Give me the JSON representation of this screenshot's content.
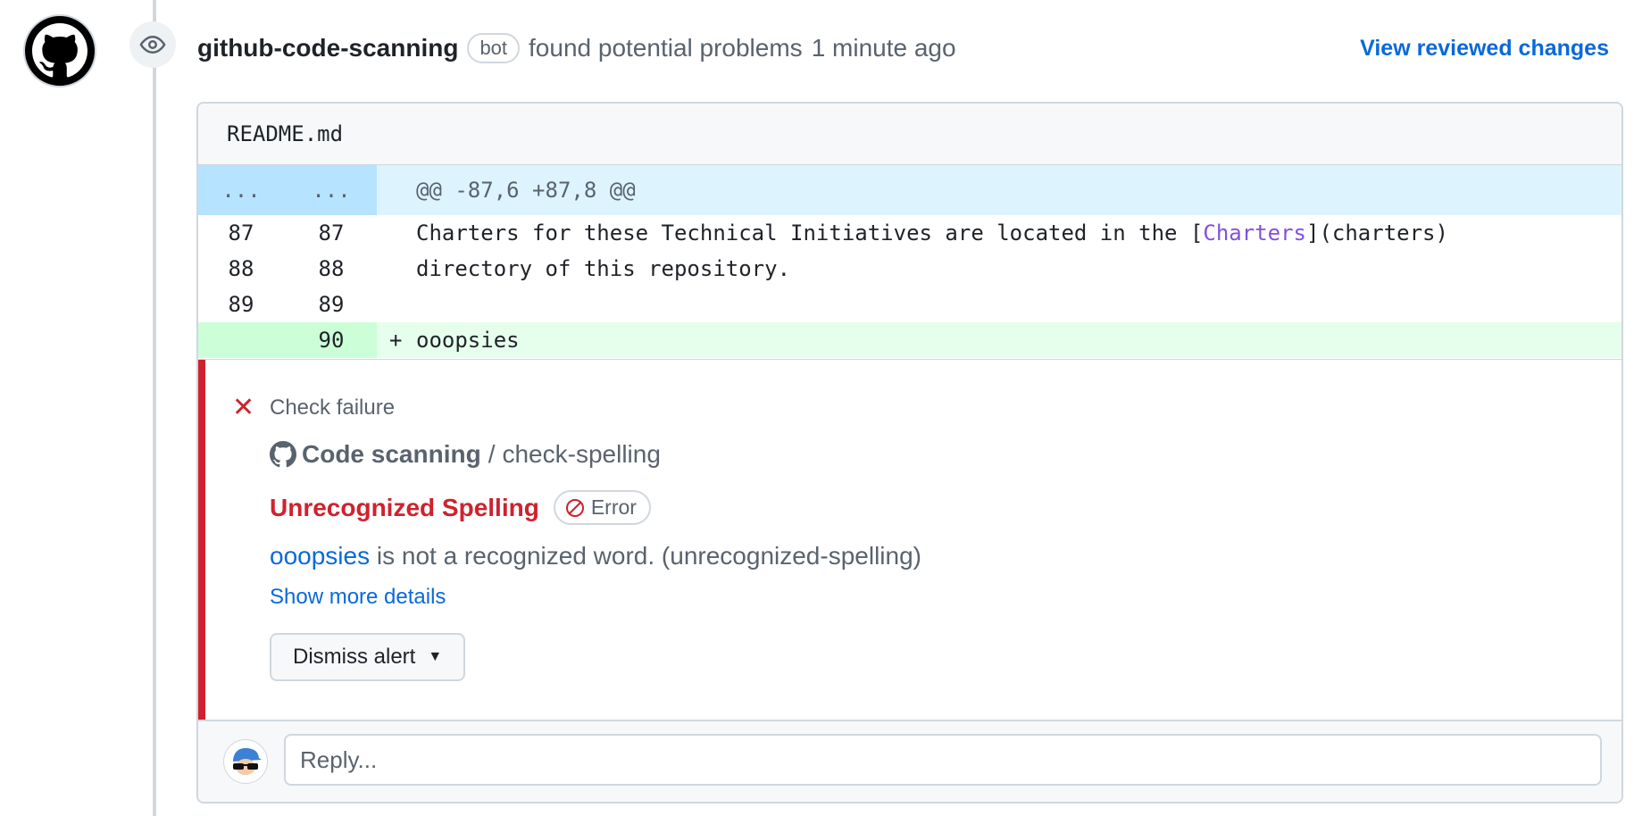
{
  "review": {
    "author": "github-code-scanning",
    "badge": "bot",
    "action_text": "found potential problems",
    "time": "1 minute ago",
    "view_changes": "View reviewed changes"
  },
  "file": {
    "name": "README.md",
    "hunk": {
      "left_ellipsis": "...",
      "right_ellipsis": "...",
      "header": "@@ -87,6 +87,8 @@"
    },
    "lines": [
      {
        "old": "87",
        "new": "87",
        "marker": "",
        "code_pre": "Charters for these Technical Initiatives are located in the [",
        "code_link": "Charters",
        "code_post": "](charters)"
      },
      {
        "old": "88",
        "new": "88",
        "marker": "",
        "code": "directory of this repository."
      },
      {
        "old": "89",
        "new": "89",
        "marker": "",
        "code": ""
      },
      {
        "old": "",
        "new": "90",
        "marker": "+",
        "code": "ooopsies"
      }
    ]
  },
  "alert": {
    "status": "Check failure",
    "tool": "Code scanning",
    "separator": "/",
    "check": "check-spelling",
    "rule": "Unrecognized Spelling",
    "severity": "Error",
    "word": "ooopsies",
    "message": " is not a recognized word. (unrecognized-spelling)",
    "more": "Show more details",
    "dismiss": "Dismiss alert"
  },
  "reply": {
    "placeholder": "Reply..."
  },
  "colors": {
    "error": "#cf222e",
    "link": "#0969da",
    "added_bg": "#e6ffec",
    "hunk_bg": "#ddf4ff"
  }
}
